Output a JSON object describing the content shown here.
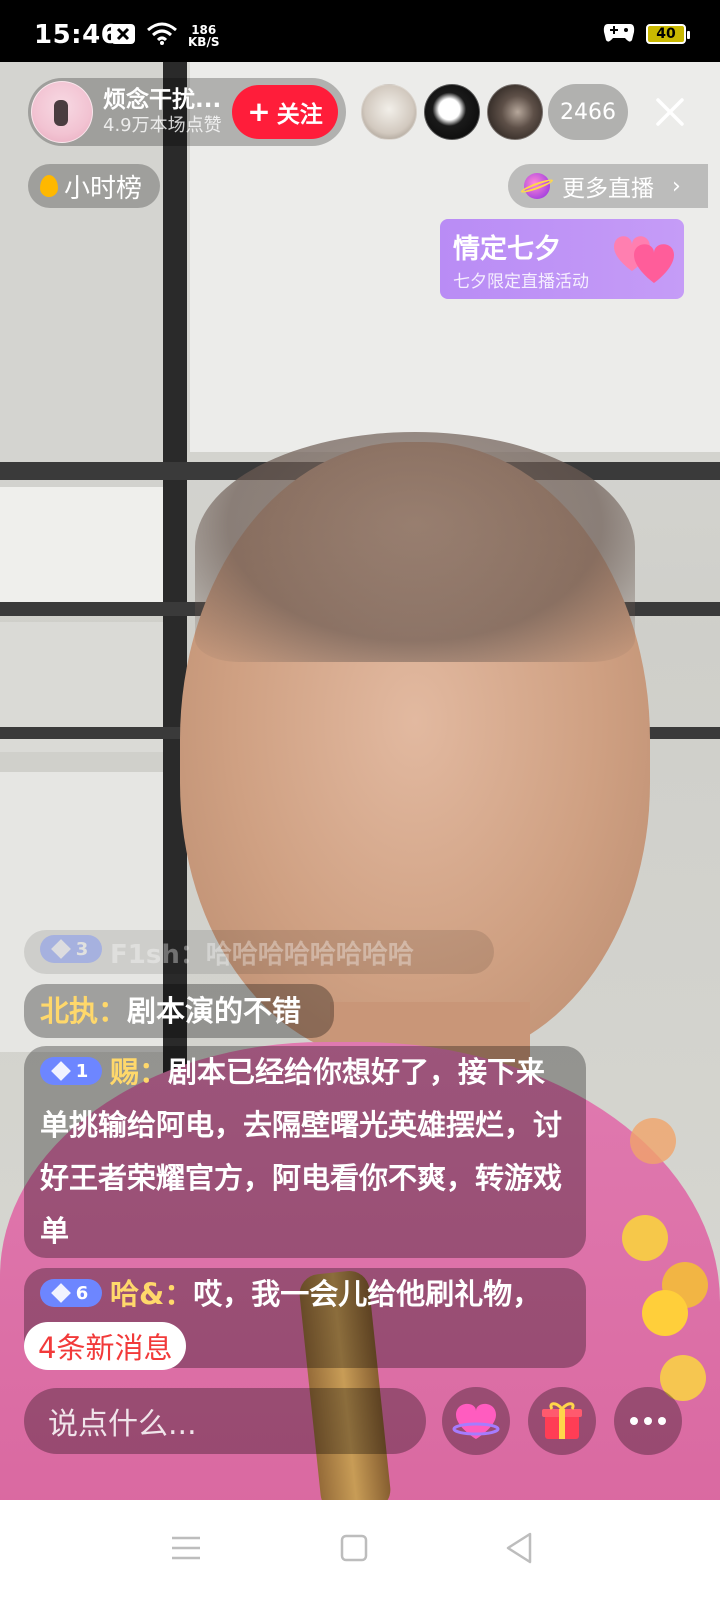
{
  "status_bar": {
    "time": "15:46",
    "net_speed_value": "186",
    "net_speed_unit": "KB/S",
    "battery": "40",
    "icons": [
      "notification-x-icon",
      "wifi-icon",
      "game-controller-icon",
      "battery-icon"
    ]
  },
  "anchor": {
    "name": "烦念干扰...",
    "likes": "4.9万本场点赞",
    "follow_label": "关注",
    "follow_prefix": "+"
  },
  "viewers": {
    "count": "2466"
  },
  "hourly_rank": {
    "label": "小时榜"
  },
  "more_live": {
    "label": "更多直播",
    "chevron": "›"
  },
  "event_banner": {
    "title": "情定七夕",
    "subtitle": "七夕限定直播活动"
  },
  "chat": {
    "faded": {
      "level": "3",
      "user": "F1sh：",
      "text": "哈哈哈哈哈哈哈哈"
    },
    "messages": [
      {
        "user": "北执：",
        "text": "剧本演的不错"
      },
      {
        "level": "1",
        "user": "赐：",
        "text": "剧本已经给你想好了，接下来单挑输给阿电，去隔壁曙光英雄摆烂，讨好王者荣耀官方，阿电看你不爽，转游戏单"
      },
      {
        "level": "6",
        "user": "哈&：",
        "text": "哎，我一会儿给他刷礼物，"
      }
    ]
  },
  "new_messages": {
    "label": "4条新消息"
  },
  "bottom_bar": {
    "input_placeholder": "说点什么...",
    "buttons": [
      "heart-planet-icon",
      "gift-icon",
      "more-icon"
    ]
  },
  "colors": {
    "follow": "#ff1d3a",
    "username": "#ffd86b",
    "event": "#c59cf7",
    "new_msg_text": "#f23a3a",
    "level_badge": "#6d86ff"
  }
}
